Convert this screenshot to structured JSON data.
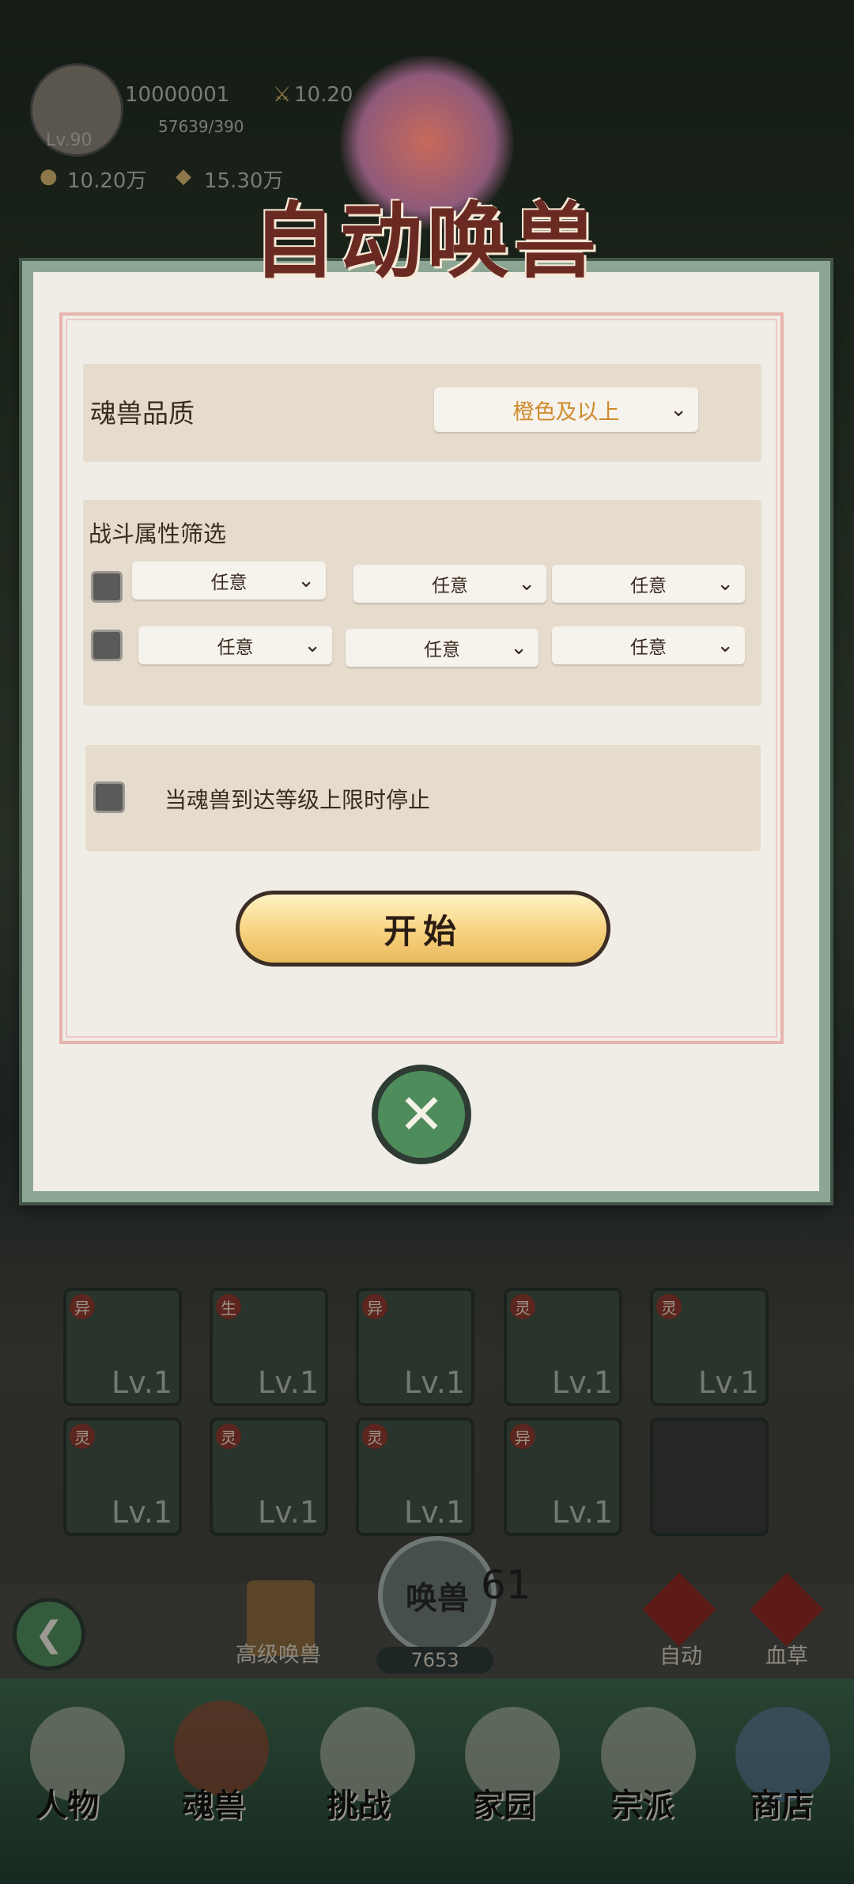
{
  "player": {
    "id": "10000001",
    "power": "10.20",
    "exp": "57639/390",
    "level": "Lv.90",
    "gold": "10.20万",
    "gems": "15.30万"
  },
  "modal": {
    "title": "自动唤兽",
    "quality_label": "魂兽品质",
    "quality_value": "橙色及以上",
    "filter_title": "战斗属性筛选",
    "filter_rows": [
      [
        "任意",
        "任意",
        "任意"
      ],
      [
        "任意",
        "任意",
        "任意"
      ]
    ],
    "stop_label": "当魂兽到达等级上限时停止",
    "start_label": "开始",
    "close_symbol": "✕"
  },
  "beasts": [
    {
      "tag": "异",
      "lv": "Lv.1"
    },
    {
      "tag": "生",
      "lv": "Lv.1"
    },
    {
      "tag": "异",
      "lv": "Lv.1"
    },
    {
      "tag": "灵",
      "lv": "Lv.1"
    },
    {
      "tag": "灵",
      "lv": "Lv.1"
    },
    {
      "tag": "灵",
      "lv": "Lv.1"
    },
    {
      "tag": "灵",
      "lv": "Lv.1"
    },
    {
      "tag": "灵",
      "lv": "Lv.1"
    },
    {
      "tag": "异",
      "lv": "Lv.1"
    }
  ],
  "summon": {
    "advanced_label": "高级唤兽",
    "main_label": "唤兽",
    "count": "61",
    "cost": "7653",
    "auto_label": "自动",
    "blood_label": "血草",
    "back_symbol": "❮"
  },
  "nav": {
    "character": "人物",
    "beast": "魂兽",
    "challenge": "挑战",
    "home": "家园",
    "sect": "宗派",
    "shop": "商店"
  }
}
